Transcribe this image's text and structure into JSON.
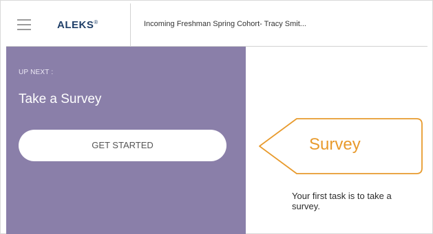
{
  "header": {
    "logo": "ALEKS",
    "logo_mark": "®",
    "class_title": "Incoming Freshman Spring Cohort- Tracy Smit..."
  },
  "up_next": {
    "label": "UP NEXT :",
    "task_title": "Take a Survey",
    "button_label": "GET STARTED"
  },
  "survey_card": {
    "label": "Survey",
    "description": "Your first task is to take a survey."
  },
  "colors": {
    "panel_purple": "#8a7fa9",
    "accent_orange": "#e89a2c",
    "logo_navy": "#1f3f68"
  },
  "icons": {
    "menu": "hamburger-menu-icon"
  }
}
